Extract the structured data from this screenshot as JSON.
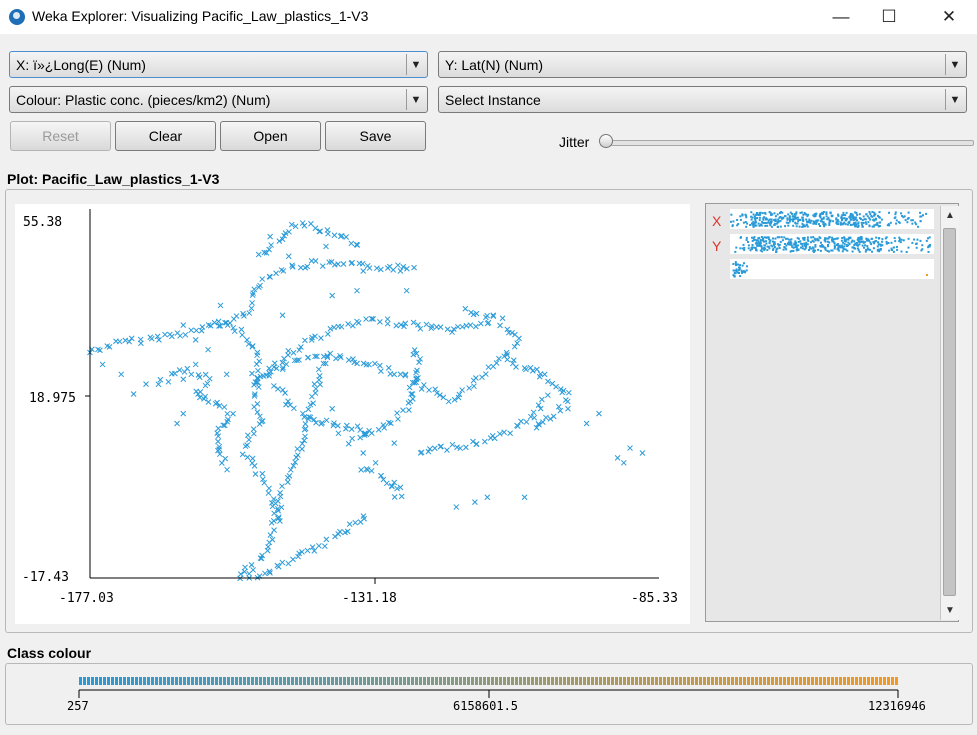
{
  "window": {
    "title": "Weka Explorer: Visualizing Pacific_Law_plastics_1-V3",
    "minimize_glyph": "—",
    "maximize_glyph": "☐",
    "close_glyph": "✕"
  },
  "controls": {
    "x_axis": "X: ï»¿Long(E) (Num)",
    "y_axis": "Y: Lat(N) (Num)",
    "colour": "Colour: Plastic conc. (pieces/km2) (Num)",
    "select_instance": "Select Instance",
    "reset_label": "Reset",
    "clear_label": "Clear",
    "open_label": "Open",
    "save_label": "Save",
    "jitter_label": "Jitter",
    "jitter_value": 0
  },
  "plot": {
    "title": "Plot: Pacific_Law_plastics_1-V3",
    "point_color": "#2a9ad8",
    "marker": "x"
  },
  "chart_data": {
    "type": "scatter",
    "xlabel": "",
    "ylabel": "",
    "x_ticks": [
      "-177.03",
      "-131.18",
      "-85.33"
    ],
    "y_ticks": [
      "55.38",
      "18.975",
      "-17.43"
    ],
    "xlim": [
      -177.03,
      -85.33
    ],
    "ylim": [
      -17.43,
      55.38
    ],
    "tracks": [
      [
        [
          -177.03,
          28.5
        ],
        [
          -173,
          30.2
        ],
        [
          -167,
          31.3
        ],
        [
          -160,
          32.8
        ],
        [
          -155,
          34.5
        ],
        [
          -152,
          36.2
        ]
      ],
      [
        [
          -152,
          36.2
        ],
        [
          -150,
          42
        ],
        [
          -147,
          45
        ],
        [
          -141,
          46.5
        ],
        [
          -133,
          46
        ],
        [
          -124,
          45.5
        ]
      ],
      [
        [
          -157,
          35
        ],
        [
          -153,
          33
        ],
        [
          -151,
          30
        ],
        [
          -150,
          27
        ],
        [
          -150.5,
          24
        ],
        [
          -150,
          21
        ],
        [
          -150.5,
          18
        ],
        [
          -149,
          15
        ],
        [
          -151,
          12
        ],
        [
          -152,
          8
        ],
        [
          -150,
          4
        ],
        [
          -148,
          0
        ],
        [
          -147,
          -4
        ],
        [
          -146,
          -7
        ]
      ],
      [
        [
          -151,
          22
        ],
        [
          -148,
          25
        ],
        [
          -143,
          30
        ],
        [
          -137,
          33.5
        ],
        [
          -131,
          35
        ],
        [
          -125,
          34
        ],
        [
          -118,
          33
        ],
        [
          -112,
          35
        ]
      ],
      [
        [
          -150,
          23
        ],
        [
          -145,
          26
        ],
        [
          -140,
          28
        ],
        [
          -135,
          27
        ],
        [
          -129,
          25
        ],
        [
          -124,
          22
        ],
        [
          -119,
          19
        ]
      ],
      [
        [
          -139,
          28
        ],
        [
          -140,
          24
        ],
        [
          -141,
          20
        ],
        [
          -142,
          15
        ],
        [
          -143,
          10
        ],
        [
          -144,
          5
        ],
        [
          -146,
          0
        ],
        [
          -147,
          -5
        ],
        [
          -148,
          -10
        ],
        [
          -150,
          -14
        ],
        [
          -153,
          -17
        ],
        [
          -149,
          -17
        ],
        [
          -145,
          -14
        ],
        [
          -140,
          -11
        ],
        [
          -136,
          -8
        ],
        [
          -132,
          -4
        ]
      ],
      [
        [
          -119,
          19
        ],
        [
          -116,
          21
        ],
        [
          -113,
          25
        ],
        [
          -110,
          28
        ],
        [
          -108,
          31
        ],
        [
          -111,
          35
        ],
        [
          -117,
          37
        ]
      ],
      [
        [
          -124,
          8
        ],
        [
          -120,
          9
        ],
        [
          -115,
          10
        ],
        [
          -110,
          12
        ],
        [
          -106,
          15
        ],
        [
          -103,
          20
        ]
      ],
      [
        [
          -110,
          27
        ],
        [
          -106,
          25
        ],
        [
          -103,
          23
        ],
        [
          -101,
          21
        ],
        [
          -100,
          19
        ],
        [
          -102,
          16
        ],
        [
          -106,
          12
        ]
      ],
      [
        [
          -150,
          48
        ],
        [
          -147,
          51
        ],
        [
          -143,
          55
        ],
        [
          -139,
          53
        ],
        [
          -133,
          50
        ]
      ],
      [
        [
          -135,
          10
        ],
        [
          -132,
          12
        ],
        [
          -129,
          14
        ],
        [
          -126,
          17
        ],
        [
          -125,
          22
        ],
        [
          -124,
          26
        ],
        [
          -125,
          30
        ]
      ],
      [
        [
          -160,
          20
        ],
        [
          -157,
          18
        ],
        [
          -154,
          16
        ],
        [
          -157,
          12
        ],
        [
          -156,
          8
        ],
        [
          -155,
          4
        ]
      ],
      [
        [
          -166,
          22
        ],
        [
          -162,
          25
        ],
        [
          -158,
          23
        ],
        [
          -160,
          19
        ]
      ],
      [
        [
          -147,
          22
        ],
        [
          -145,
          18
        ],
        [
          -142,
          15
        ],
        [
          -138,
          14
        ],
        [
          -134,
          13
        ],
        [
          -131,
          12
        ]
      ],
      [
        [
          -133,
          5
        ],
        [
          -130,
          3
        ],
        [
          -128,
          1
        ],
        [
          -127,
          -2
        ]
      ]
    ],
    "scattered": [
      [
        -88,
        8
      ],
      [
        -90,
        9
      ],
      [
        -92,
        7
      ],
      [
        -91,
        6
      ],
      [
        -97,
        14
      ],
      [
        -95,
        16
      ],
      [
        -100,
        17
      ],
      [
        -105,
        25
      ],
      [
        -113,
        -1
      ],
      [
        -115,
        -2
      ],
      [
        -118,
        -3
      ],
      [
        -107,
        -1
      ],
      [
        -127,
        1
      ],
      [
        -128,
        2
      ],
      [
        -131,
        6
      ],
      [
        -133,
        8
      ],
      [
        -128,
        10
      ],
      [
        -125,
        19
      ],
      [
        -137,
        12
      ],
      [
        -138,
        17
      ],
      [
        -126,
        41
      ],
      [
        -127,
        45
      ],
      [
        -133,
        45
      ],
      [
        -139,
        50
      ],
      [
        -145,
        48
      ],
      [
        -148,
        52
      ],
      [
        -155,
        24
      ],
      [
        -160,
        26
      ],
      [
        -162,
        23
      ],
      [
        -168,
        22
      ],
      [
        -170,
        20
      ],
      [
        -172,
        24
      ],
      [
        -175,
        26
      ],
      [
        -162,
        34
      ],
      [
        -160,
        31
      ],
      [
        -162,
        16
      ],
      [
        -163,
        14
      ],
      [
        -158,
        29
      ],
      [
        -156,
        38
      ],
      [
        -146,
        36
      ],
      [
        -138,
        40
      ],
      [
        -134,
        41
      ]
    ]
  },
  "attribute_panel": {
    "x_label": "X",
    "y_label": "Y"
  },
  "class_colour": {
    "title": "Class colour",
    "min": "257",
    "mid": "6158601.5",
    "max": "12316946",
    "start_color": "#2a9ad8",
    "end_color": "#f39a20"
  }
}
